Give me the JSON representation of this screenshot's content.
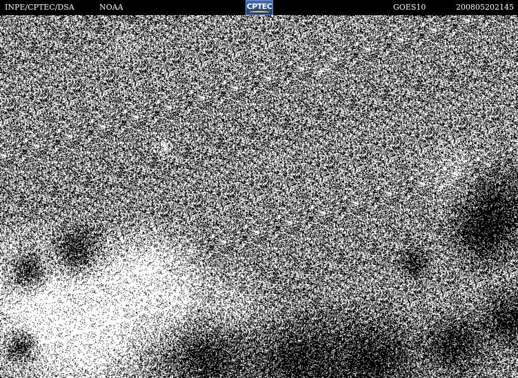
{
  "header": {
    "left_label": "INPE/CPTEC/DSA",
    "agency_label": "NOAA",
    "logo_text": "CPTEC",
    "satellite_label": "GOES10",
    "timestamp": "200805202145"
  },
  "image": {
    "type": "satellite-imagery",
    "colors": {
      "noise_dark": "#000000",
      "noise_light": "#ffffff",
      "header_bg": "#000000",
      "logo_blue": "#2a4f93",
      "logo_accent": "#e6c64a"
    }
  }
}
